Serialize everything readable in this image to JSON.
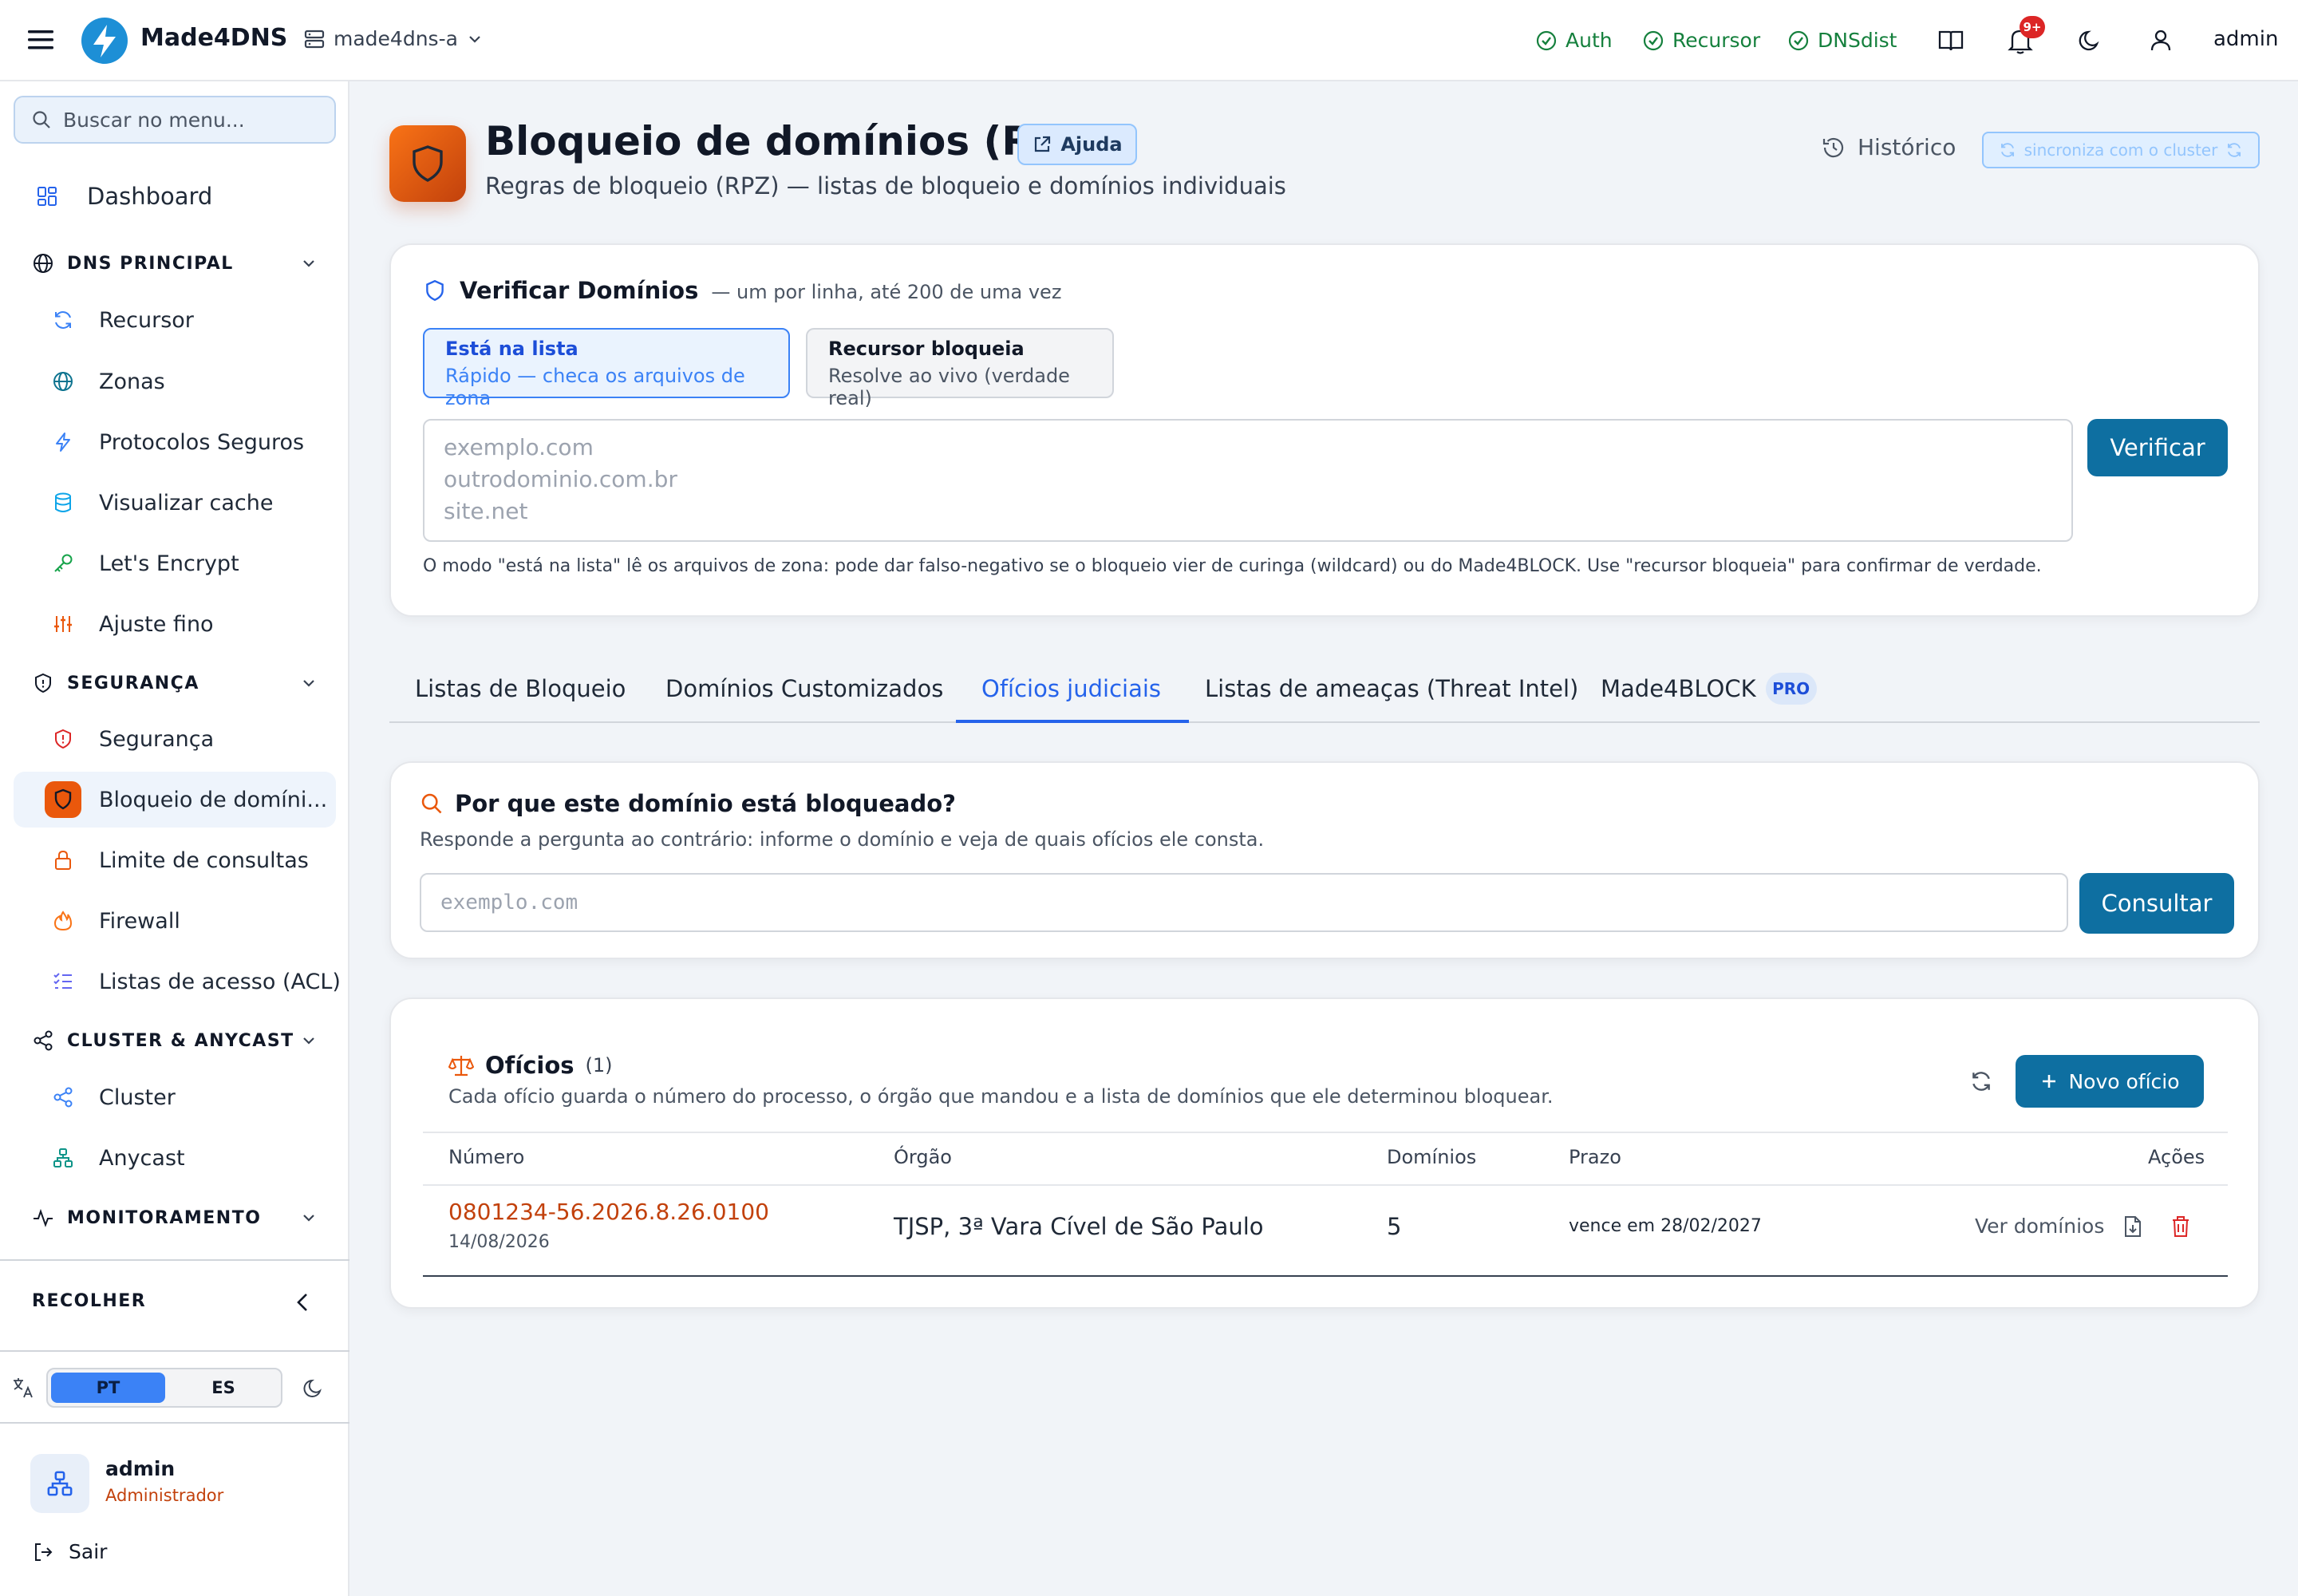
{
  "topbar": {
    "brand": "Made4DNS",
    "server": "made4dns-a",
    "services": [
      "Auth",
      "Recursor",
      "DNSdist"
    ],
    "notifications_badge": "9+",
    "user": "admin"
  },
  "sidebar": {
    "search_placeholder": "Buscar no menu...",
    "dashboard": "Dashboard",
    "sections": {
      "dns": "DNS PRINCIPAL",
      "security": "SEGURANÇA",
      "cluster": "CLUSTER & ANYCAST",
      "monitoring": "MONITORAMENTO"
    },
    "items": {
      "recursor": "Recursor",
      "zonas": "Zonas",
      "protocolos": "Protocolos Seguros",
      "cache": "Visualizar cache",
      "letsencrypt": "Let's Encrypt",
      "ajuste": "Ajuste fino",
      "seguranca": "Segurança",
      "bloqueio": "Bloqueio de domíni...",
      "limite": "Limite de consultas",
      "firewall": "Firewall",
      "acl": "Listas de acesso (ACL)",
      "cluster": "Cluster",
      "anycast": "Anycast"
    },
    "collapse": "RECOLHER",
    "lang_pt": "PT",
    "lang_es": "ES",
    "user_name": "admin",
    "user_role": "Administrador",
    "logout": "Sair"
  },
  "page": {
    "title": "Bloqueio de domínios (RPZ)",
    "help": "Ajuda",
    "subtitle": "Regras de bloqueio (RPZ) — listas de bloqueio e domínios individuais",
    "history": "Histórico",
    "sync": "sincroniza com o cluster"
  },
  "verify": {
    "title": "Verificar Domínios",
    "subtitle": "— um por linha, até 200 de uma vez",
    "mode1_title": "Está na lista",
    "mode1_desc": "Rápido — checa os arquivos de zona",
    "mode2_title": "Recursor bloqueia",
    "mode2_desc": "Resolve ao vivo (verdade real)",
    "placeholder": "exemplo.com\noutrodominio.com.br\nsite.net",
    "button": "Verificar",
    "note": "O modo \"está na lista\" lê os arquivos de zona: pode dar falso-negativo se o bloqueio vier de curinga (wildcard) ou do Made4BLOCK. Use \"recursor bloqueia\" para confirmar de verdade."
  },
  "tabs": {
    "t1": "Listas de Bloqueio",
    "t2": "Domínios Customizados",
    "t3": "Ofícios judiciais",
    "t4": "Listas de ameaças (Threat Intel)",
    "t5": "Made4BLOCK",
    "pro": "PRO"
  },
  "why": {
    "title": "Por que este domínio está bloqueado?",
    "subtitle": "Responde a pergunta ao contrário: informe o domínio e veja de quais ofícios ele consta.",
    "placeholder": "exemplo.com",
    "button": "Consultar"
  },
  "oficios": {
    "title": "Ofícios",
    "count": "(1)",
    "subtitle": "Cada ofício guarda o número do processo, o órgão que mandou e a lista de domínios que ele determinou bloquear.",
    "new_button": "Novo ofício",
    "headers": {
      "numero": "Número",
      "orgao": "Órgão",
      "dominios": "Domínios",
      "prazo": "Prazo",
      "acoes": "Ações"
    },
    "rows": [
      {
        "numero": "0801234-56.2026.8.26.0100",
        "data": "14/08/2026",
        "orgao": "TJSP, 3ª Vara Cível de São Paulo",
        "dominios": "5",
        "prazo": "vence em 28/02/2027",
        "ver": "Ver domínios"
      }
    ]
  }
}
